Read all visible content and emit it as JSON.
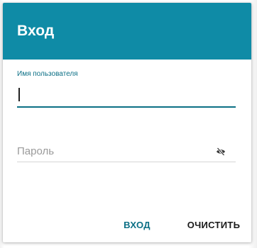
{
  "dialog": {
    "title": "Вход",
    "header_color": "#0f8ba6"
  },
  "username": {
    "label": "Имя пользователя",
    "value": "",
    "accent_color": "#0b6f85"
  },
  "password": {
    "placeholder": "Пароль",
    "value": "",
    "toggle_icon": "eye-off-icon"
  },
  "actions": {
    "login_label": "ВХОД",
    "clear_label": "ОЧИСТИТЬ"
  }
}
